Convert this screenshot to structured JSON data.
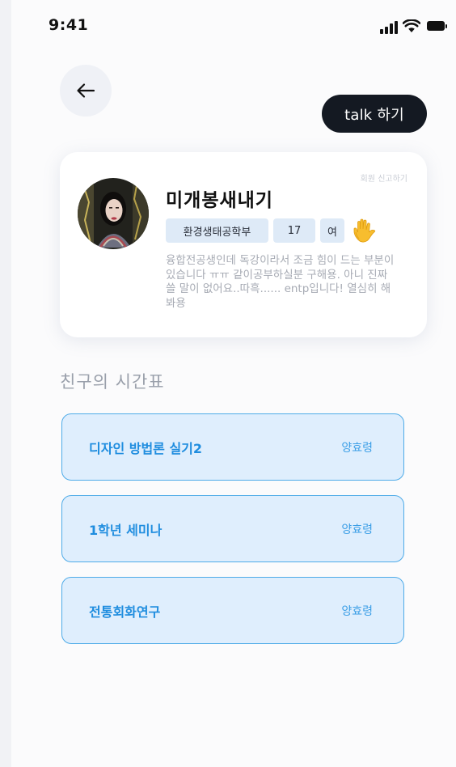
{
  "status_bar": {
    "time": "9:41"
  },
  "header": {
    "talk_button_label": "talk 하기"
  },
  "profile": {
    "report_label": "회원 신고하기",
    "nickname": "미개봉새내기",
    "department": "환경생태공학부",
    "student_number": "17",
    "gender": "여",
    "bio": "융합전공생인데 독강이라서 조금 힘이 드는 부분이 있습니다 ㅠㅠ 같이공부하실분 구해용. 아니 진짜 쓸 말이 없어요..따흑...... entp입니다! 열심히 해봐용"
  },
  "timetable": {
    "title": "친구의 시간표",
    "classes": [
      {
        "name": "디자인 방법론 실기2",
        "professor": "양효령"
      },
      {
        "name": "1학년 세미나",
        "professor": "양효령"
      },
      {
        "name": "전통회화연구",
        "professor": "양효령"
      }
    ]
  },
  "colors": {
    "accent": "#1f8ddf",
    "card_fill": "#dfeefd",
    "card_border": "#4eabe8",
    "tag_fill": "#deeaf7",
    "talk_button": "#141922"
  },
  "icons": [
    "signal-icon",
    "wifi-icon",
    "battery-icon",
    "back-arrow-icon",
    "raised-hand-icon"
  ]
}
